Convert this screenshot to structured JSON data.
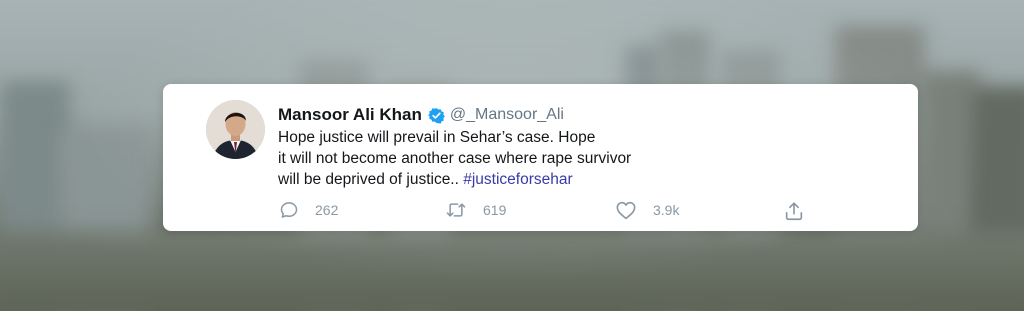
{
  "tweet": {
    "author_name": "Mansoor Ali Khan",
    "handle": "@_Mansoor_Ali",
    "verified": true,
    "text_lines": [
      "Hope justice will prevail in Sehar’s case. Hope",
      "it will not become another case where rape survivor",
      "will be deprived of justice.. "
    ],
    "hashtag": "#justiceforsehar"
  },
  "actions": {
    "replies": "262",
    "retweets": "619",
    "likes": "3.9k"
  },
  "colors": {
    "card": "#ffffff",
    "verified_badge": "#1da1f2",
    "hashtag": "#3a3aa8",
    "muted": "#8a98a5"
  },
  "icons": {
    "reply": "reply-icon",
    "retweet": "retweet-icon",
    "like": "heart-icon",
    "share": "share-icon"
  }
}
